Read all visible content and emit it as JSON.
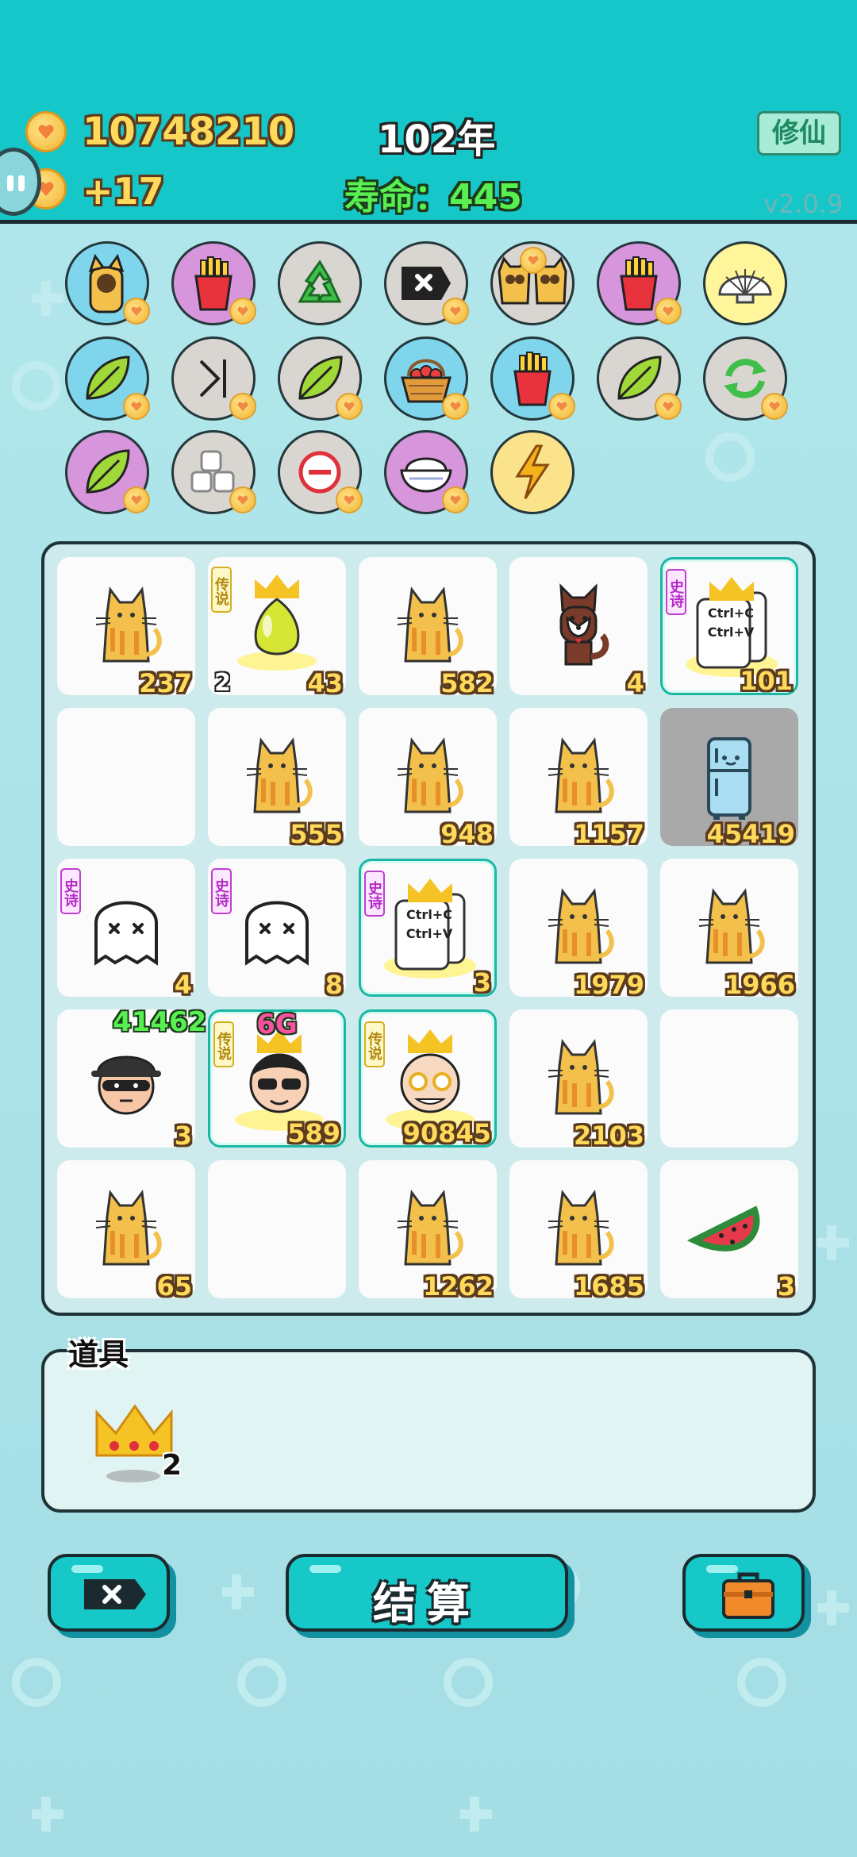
{
  "header": {
    "money": "10748210",
    "income": "+17",
    "year": "102年",
    "life": "寿命：445",
    "xiuxian_label": "修仙",
    "version": "v2.0.9"
  },
  "skills": [
    {
      "icon": "cat-peek-icon",
      "color": "blue"
    },
    {
      "icon": "fries-icon",
      "color": "pink"
    },
    {
      "icon": "recycle-icon",
      "color": "gray"
    },
    {
      "icon": "delete-tag-icon",
      "color": "gray"
    },
    {
      "icon": "twin-cats-icon",
      "color": "gray"
    },
    {
      "icon": "fries-icon",
      "color": "pink"
    },
    {
      "icon": "shell-icon",
      "color": "yellow"
    },
    {
      "icon": "leaf-icon",
      "color": "blue"
    },
    {
      "icon": "skip-icon",
      "color": "gray"
    },
    {
      "icon": "leaf-icon",
      "color": "gray"
    },
    {
      "icon": "fruit-basket-icon",
      "color": "blue"
    },
    {
      "icon": "fries-icon",
      "color": "blue"
    },
    {
      "icon": "leaf-icon",
      "color": "gray"
    },
    {
      "icon": "refresh-icon",
      "color": "gray"
    },
    {
      "icon": "leaf-icon",
      "color": "pink"
    },
    {
      "icon": "sugar-cubes-icon",
      "color": "gray"
    },
    {
      "icon": "minus-icon",
      "color": "gray"
    },
    {
      "icon": "rice-bowl-icon",
      "color": "pink"
    },
    {
      "icon": "lightning-icon",
      "color": "yellow"
    }
  ],
  "board": {
    "cells": [
      {
        "item": "cat",
        "count": "237"
      },
      {
        "item": "pomelo",
        "count": "43",
        "level": "2",
        "tag": "传说",
        "crown": true
      },
      {
        "item": "cat",
        "count": "582"
      },
      {
        "item": "husky",
        "count": "4"
      },
      {
        "item": "ctrl-cv",
        "count": "101",
        "tag": "史诗",
        "crown": true,
        "selected": true,
        "text": "Ctrl+C\nCtrl+V"
      },
      {
        "item": "empty"
      },
      {
        "item": "cat",
        "count": "555"
      },
      {
        "item": "cat",
        "count": "948"
      },
      {
        "item": "cat",
        "count": "1157"
      },
      {
        "item": "fridge",
        "count": "45419",
        "dark": true
      },
      {
        "item": "ghost",
        "count": "4",
        "tag": "史诗"
      },
      {
        "item": "ghost",
        "count": "8",
        "tag": "史诗"
      },
      {
        "item": "ctrl-cv",
        "count": "3",
        "tag": "史诗",
        "crown": true,
        "selected": true,
        "text": "Ctrl+C\nCtrl+V"
      },
      {
        "item": "cat",
        "count": "1979"
      },
      {
        "item": "cat",
        "count": "1966"
      },
      {
        "item": "thief",
        "count": "3",
        "top": "41462"
      },
      {
        "item": "sunglasses-man",
        "count": "589",
        "tag": "传说",
        "crown": true,
        "selected": true,
        "top": "6G"
      },
      {
        "item": "old-man",
        "count": "90845",
        "tag": "传说",
        "crown": true,
        "selected": true
      },
      {
        "item": "cat",
        "count": "2103"
      },
      {
        "item": "empty"
      },
      {
        "item": "cat",
        "count": "65"
      },
      {
        "item": "empty"
      },
      {
        "item": "cat",
        "count": "1262"
      },
      {
        "item": "cat",
        "count": "1685"
      },
      {
        "item": "watermelon",
        "count": "3"
      }
    ]
  },
  "props": {
    "title": "道具",
    "items": [
      {
        "icon": "crown-icon",
        "count": "2"
      }
    ]
  },
  "buttons": {
    "settle_label": "结算",
    "close_icon": "close-tag-icon",
    "bag_icon": "briefcase-icon"
  },
  "colors": {
    "header": "#16c7c9",
    "count_text": "#ffd95a",
    "life_text": "#58f050",
    "epic_tag": "#c03fd0",
    "legend_tag": "#d4b020"
  }
}
